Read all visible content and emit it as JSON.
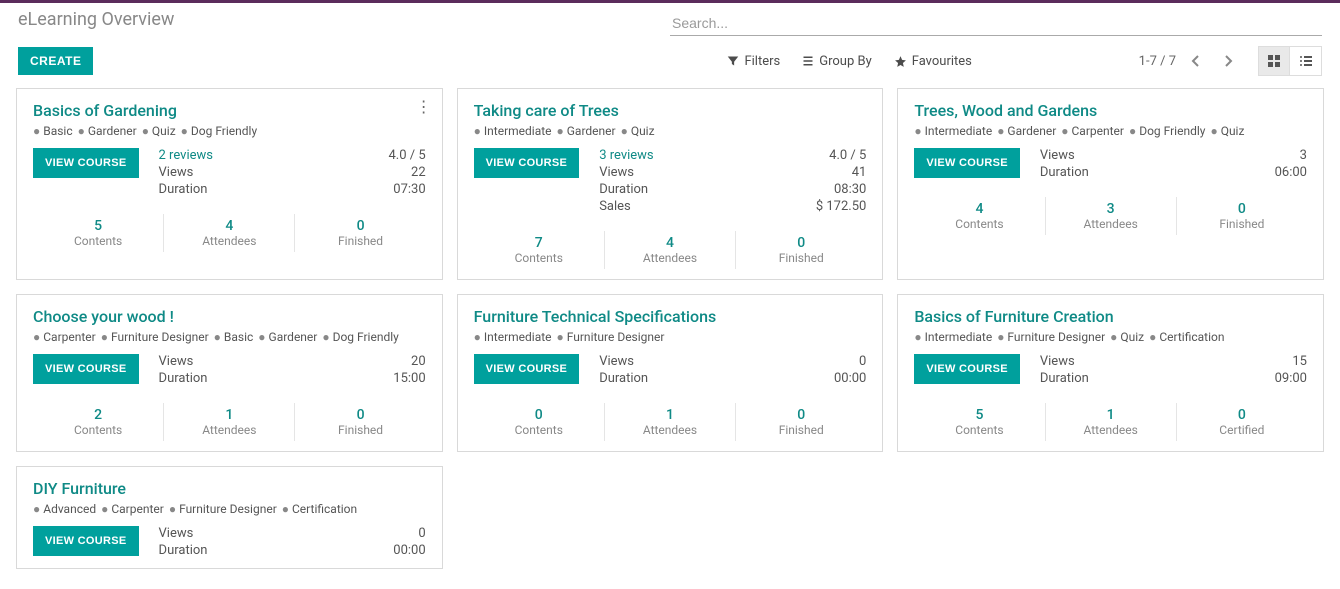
{
  "header": {
    "title": "eLearning Overview",
    "search_placeholder": "Search...",
    "create_label": "CREATE",
    "filters_label": "Filters",
    "group_by_label": "Group By",
    "favourites_label": "Favourites",
    "pager": "1-7 / 7"
  },
  "labels": {
    "view_course": "VIEW COURSE",
    "reviews_suffix": " reviews",
    "views": "Views",
    "duration": "Duration",
    "sales": "Sales",
    "contents": "Contents",
    "attendees": "Attendees",
    "finished": "Finished",
    "certified": "Certified"
  },
  "cards": [
    {
      "title": "Basics of Gardening",
      "show_kebab": true,
      "tags": [
        "Basic",
        "Gardener",
        "Quiz",
        "Dog Friendly"
      ],
      "reviews": "2",
      "rating": "4.0 / 5",
      "views": "22",
      "duration": "07:30",
      "sales": null,
      "stats": [
        {
          "value": "5",
          "label_key": "contents"
        },
        {
          "value": "4",
          "label_key": "attendees"
        },
        {
          "value": "0",
          "label_key": "finished"
        }
      ]
    },
    {
      "title": "Taking care of Trees",
      "tags": [
        "Intermediate",
        "Gardener",
        "Quiz"
      ],
      "reviews": "3",
      "rating": "4.0 / 5",
      "views": "41",
      "duration": "08:30",
      "sales": "$ 172.50",
      "stats": [
        {
          "value": "7",
          "label_key": "contents"
        },
        {
          "value": "4",
          "label_key": "attendees"
        },
        {
          "value": "0",
          "label_key": "finished"
        }
      ]
    },
    {
      "title": "Trees, Wood and Gardens",
      "tags": [
        "Intermediate",
        "Gardener",
        "Carpenter",
        "Dog Friendly",
        "Quiz"
      ],
      "reviews": null,
      "rating": null,
      "views": "3",
      "duration": "06:00",
      "sales": null,
      "stats": [
        {
          "value": "4",
          "label_key": "contents"
        },
        {
          "value": "3",
          "label_key": "attendees"
        },
        {
          "value": "0",
          "label_key": "finished"
        }
      ]
    },
    {
      "title": "Choose your wood !",
      "tags": [
        "Carpenter",
        "Furniture Designer",
        "Basic",
        "Gardener",
        "Dog Friendly"
      ],
      "reviews": null,
      "rating": null,
      "views": "20",
      "duration": "15:00",
      "sales": null,
      "stats": [
        {
          "value": "2",
          "label_key": "contents"
        },
        {
          "value": "1",
          "label_key": "attendees"
        },
        {
          "value": "0",
          "label_key": "finished"
        }
      ]
    },
    {
      "title": "Furniture Technical Specifications",
      "tags": [
        "Intermediate",
        "Furniture Designer"
      ],
      "reviews": null,
      "rating": null,
      "views": "0",
      "duration": "00:00",
      "sales": null,
      "stats": [
        {
          "value": "0",
          "label_key": "contents"
        },
        {
          "value": "1",
          "label_key": "attendees"
        },
        {
          "value": "0",
          "label_key": "finished"
        }
      ]
    },
    {
      "title": "Basics of Furniture Creation",
      "tags": [
        "Intermediate",
        "Furniture Designer",
        "Quiz",
        "Certification"
      ],
      "reviews": null,
      "rating": null,
      "views": "15",
      "duration": "09:00",
      "sales": null,
      "stats": [
        {
          "value": "5",
          "label_key": "contents"
        },
        {
          "value": "1",
          "label_key": "attendees"
        },
        {
          "value": "0",
          "label_key": "certified"
        }
      ]
    },
    {
      "title": "DIY Furniture",
      "tags": [
        "Advanced",
        "Carpenter",
        "Furniture Designer",
        "Certification"
      ],
      "reviews": null,
      "rating": null,
      "views": "0",
      "duration": "00:00",
      "sales": null,
      "stats": null
    }
  ]
}
